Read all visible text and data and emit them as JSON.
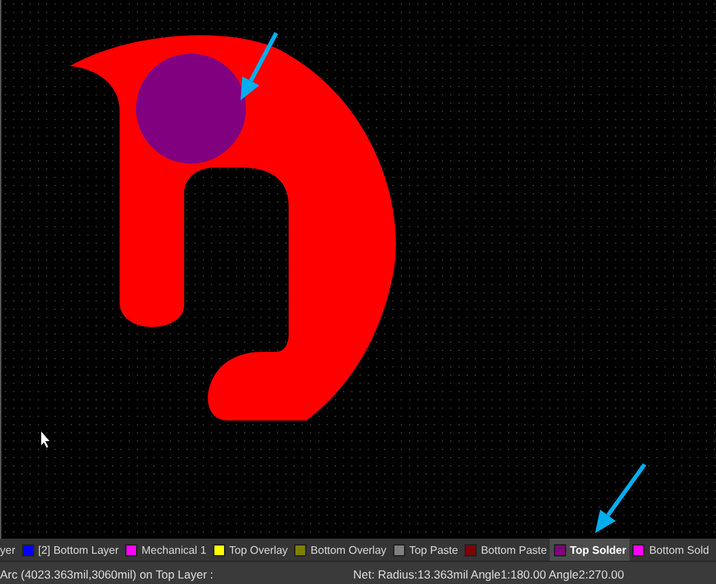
{
  "layer_tabs": [
    {
      "label": "yer",
      "selected": false
    },
    {
      "label": "[2] Bottom Layer",
      "color": "#0000ff",
      "selected": false
    },
    {
      "label": "Mechanical 1",
      "color": "#ff00ff",
      "selected": false
    },
    {
      "label": "Top Overlay",
      "color": "#ffff00",
      "selected": false
    },
    {
      "label": "Bottom Overlay",
      "color": "#808000",
      "selected": false
    },
    {
      "label": "Top Paste",
      "color": "#808080",
      "selected": false
    },
    {
      "label": "Bottom Paste",
      "color": "#800000",
      "selected": false
    },
    {
      "label": "Top Solder",
      "color": "#800080",
      "selected": true
    },
    {
      "label": "Bottom Sold",
      "color": "#ff00ff",
      "selected": false
    }
  ],
  "status_bar": {
    "left": "Arc (4023.363mil,3060mil) on Top Layer :",
    "right": "Net: Radius:13.363mil Angle1:180.00 Angle2:270.00"
  }
}
